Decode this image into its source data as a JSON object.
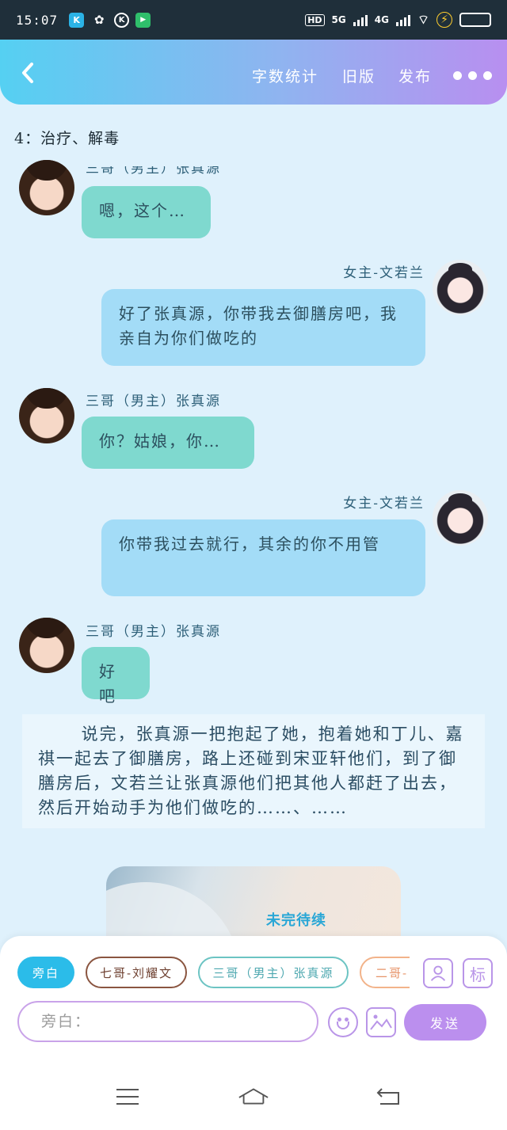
{
  "status_bar": {
    "time": "15:07",
    "apps": [
      "K",
      "WeChat",
      "K",
      "TV"
    ],
    "network_hd": "HD",
    "network_5g": "5G",
    "network_4g": "4G",
    "battery": "⚡"
  },
  "header": {
    "actions": [
      "字数统计",
      "旧版",
      "发布"
    ]
  },
  "content": {
    "heading": "4：治疗、解毒",
    "messages": [
      {
        "side": "left",
        "speaker": "三哥（男主）张真源",
        "text": "嗯，这个…"
      },
      {
        "side": "right",
        "speaker": "女主-文若兰",
        "text": "好了张真源，你带我去御膳房吧，我亲自为你们做吃的"
      },
      {
        "side": "left",
        "speaker": "三哥（男主）张真源",
        "text": "你？姑娘，你…"
      },
      {
        "side": "right",
        "speaker": "女主-文若兰",
        "text": "你带我过去就行，其余的你不用管"
      },
      {
        "side": "left",
        "speaker": "三哥（男主）张真源",
        "text": "好吧"
      }
    ],
    "narration": "说完，张真源一把抱起了她，抱着她和丁儿、嘉祺一起去了御膳房，路上还碰到宋亚轩他们，到了御膳房后，文若兰让张真源他们把其他人都赶了出去，然后开始动手为他们做吃的……、……",
    "image_caption": "未完待续"
  },
  "input_panel": {
    "roles": [
      "旁白",
      "七哥-刘耀文",
      "三哥（男主）张真源",
      "二哥-"
    ],
    "input_placeholder": "旁白：",
    "send_label": "发送",
    "tag_label": "标"
  },
  "colors": {
    "header_start": "#55d0f2",
    "header_end": "#b88ff0",
    "male_bubble": "#7fd9cf",
    "female_bubble": "#a3dcf7",
    "send": "#bb8fee"
  }
}
